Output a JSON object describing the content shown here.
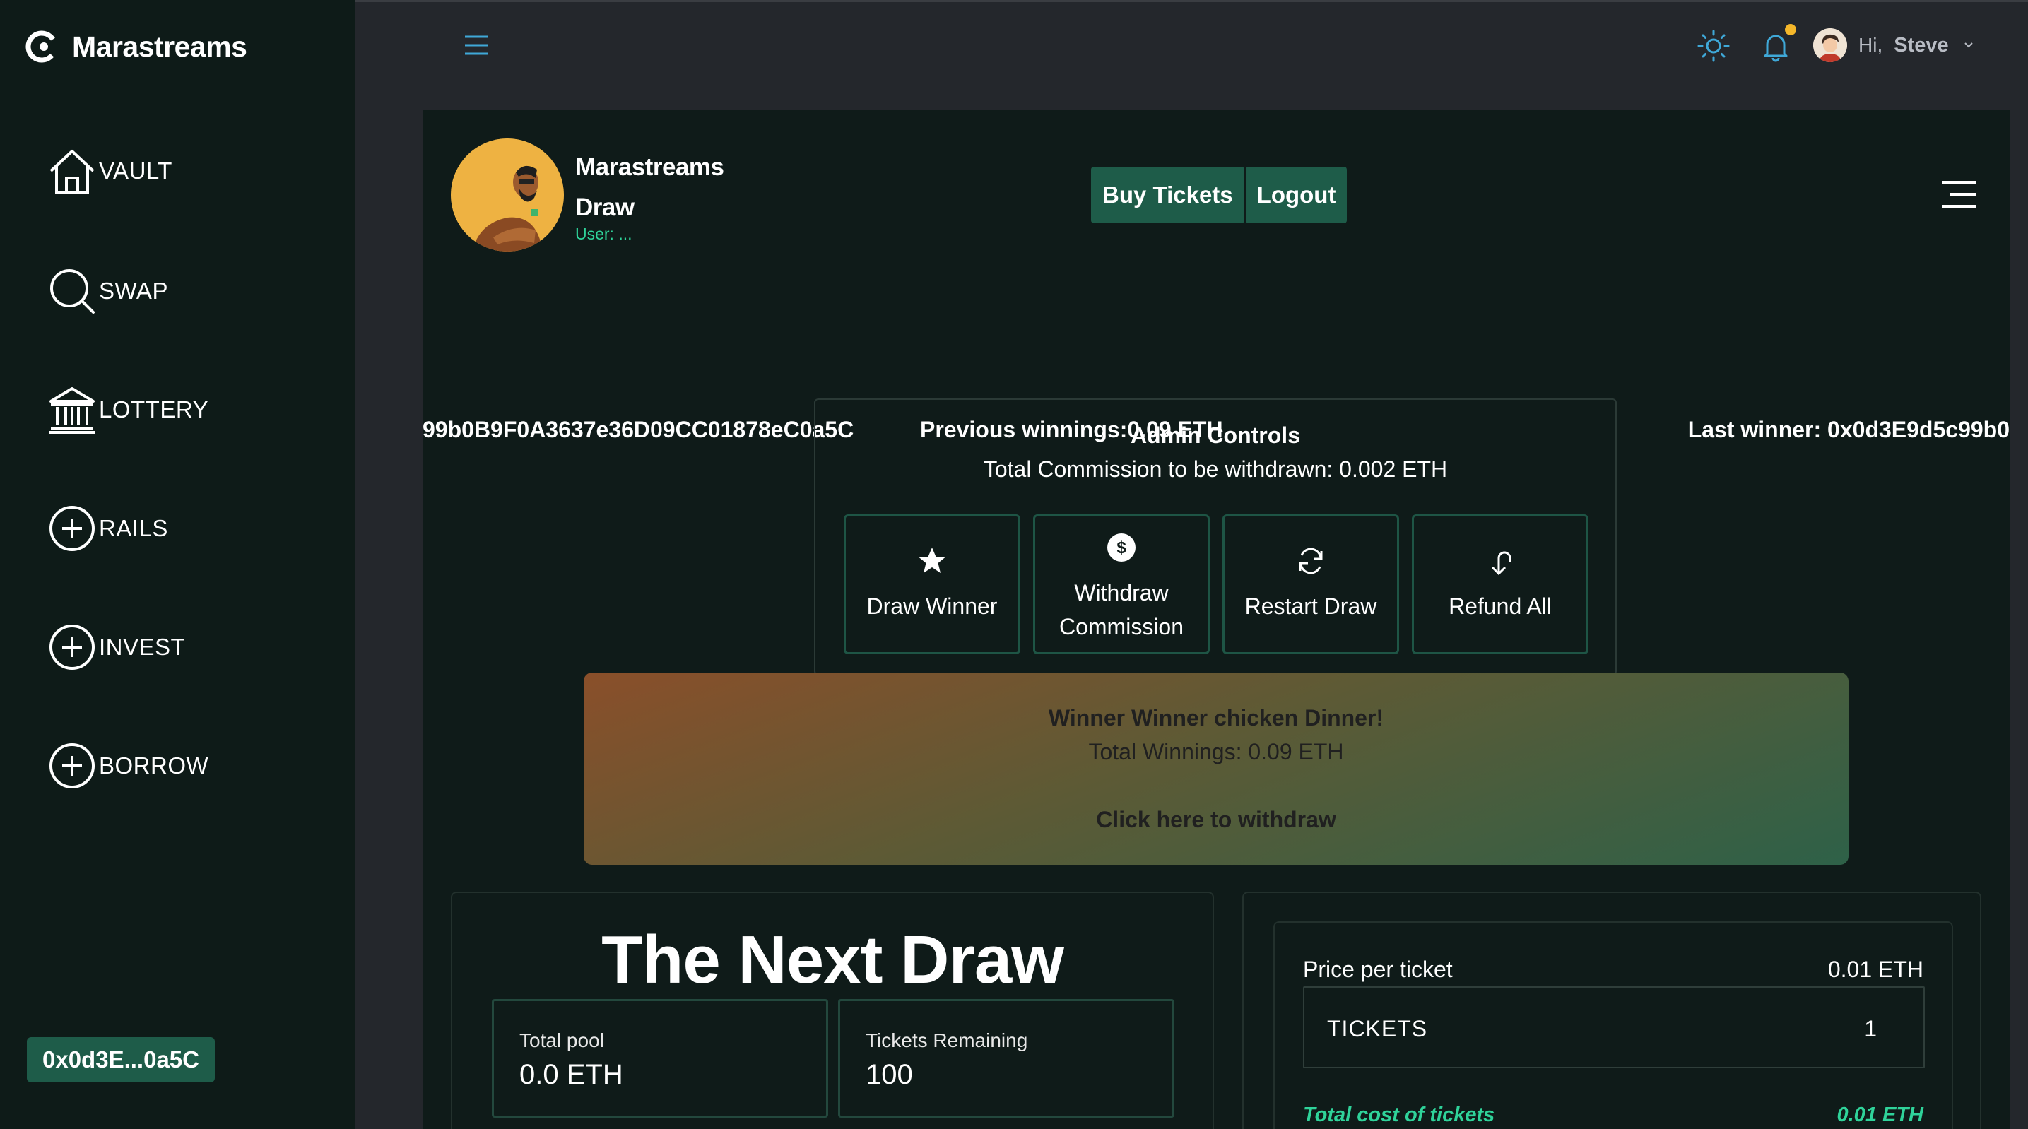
{
  "sidebar": {
    "brand": "Marastreams",
    "items": [
      {
        "label": "VAULT",
        "icon": "home-icon"
      },
      {
        "label": "SWAP",
        "icon": "search-icon"
      },
      {
        "label": "LOTTERY",
        "icon": "bank-icon"
      },
      {
        "label": "RAILS",
        "icon": "plus-circle-icon"
      },
      {
        "label": "INVEST",
        "icon": "plus-circle-icon"
      },
      {
        "label": "BORROW",
        "icon": "plus-circle-icon"
      }
    ],
    "wallet": "0x0d3E...0a5C"
  },
  "topbar": {
    "greeting": "Hi,",
    "user_name": "Steve",
    "accent_icon_color": "#3fa8d8",
    "notification_dot_color": "#f5b72a"
  },
  "profile": {
    "name_line1": "Marastreams",
    "name_line2": "Draw",
    "user_label": "User: ..."
  },
  "actions": {
    "buy": "Buy Tickets",
    "logout": "Logout"
  },
  "info": {
    "address": "99b0B9F0A3637e36D09CC01878eC0a5C",
    "previous_winnings": "Previous winnings:0.09 ETH",
    "last_winner": "Last winner: 0x0d3E9d5c99b0"
  },
  "admin": {
    "title": "Admin Controls",
    "commission": "Total Commission to be withdrawn: 0.002 ETH",
    "buttons": [
      {
        "label": "Draw Winner",
        "icon": "star-icon"
      },
      {
        "label": "Withdraw Commission",
        "icon": "dollar-circle-icon"
      },
      {
        "label": "Restart Draw",
        "icon": "refresh-icon"
      },
      {
        "label": "Refund All",
        "icon": "undo-arrow-icon"
      }
    ]
  },
  "winner": {
    "title": "Winner Winner chicken Dinner!",
    "total": "Total Winnings: 0.09 ETH",
    "link": "Click here to withdraw"
  },
  "next_draw": {
    "title": "The Next Draw",
    "pool_label": "Total pool",
    "pool_value": "0.0 ETH",
    "remaining_label": "Tickets Remaining",
    "remaining_value": "100"
  },
  "tickets": {
    "price_label": "Price per ticket",
    "price_value": "0.01 ETH",
    "field_label": "TICKETS",
    "quantity": "1",
    "total_label": "Total cost of tickets",
    "total_value": "0.01 ETH"
  },
  "colors": {
    "sidebar_bg": "#0e1b18",
    "page_bg": "#24272c",
    "panel_bg": "#0f1b19",
    "accent_green": "#1e5c49",
    "highlight_green": "#2fd39a"
  }
}
